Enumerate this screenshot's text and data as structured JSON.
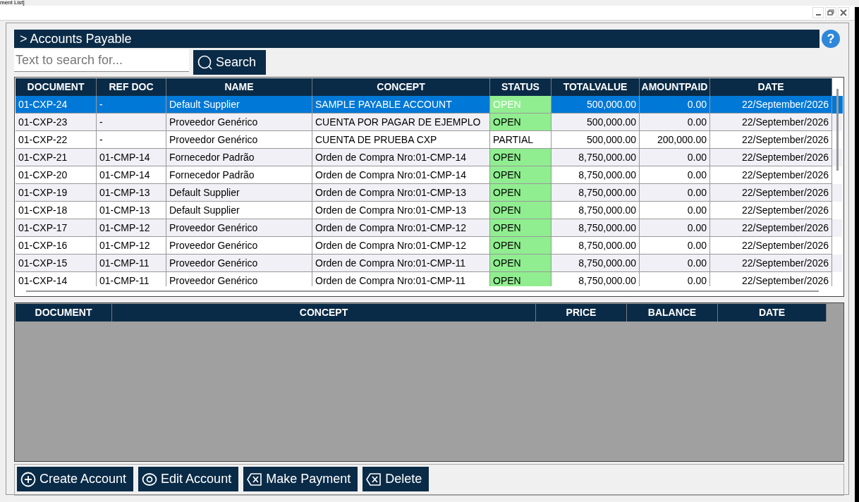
{
  "window": {
    "title": "ment List]"
  },
  "header": {
    "title": "> Accounts Payable",
    "help": "?"
  },
  "search": {
    "placeholder": "Text to search for...",
    "button": "Search"
  },
  "accounts": {
    "columns": [
      "DOCUMENT",
      "REF DOC",
      "NAME",
      "CONCEPT",
      "STATUS",
      "TOTALVALUE",
      "AMOUNTPAID",
      "DATE"
    ],
    "rows": [
      {
        "selected": true,
        "cells": [
          "01-CXP-24",
          "-",
          "Default Supplier",
          "SAMPLE PAYABLE ACCOUNT",
          "OPEN",
          "500,000.00",
          "0.00",
          "22/September/2026"
        ],
        "color": "#90ee90"
      },
      {
        "selected": false,
        "cells": [
          "01-CXP-23",
          "-",
          "Proveedor Genérico",
          "CUENTA POR PAGAR DE EJEMPLO",
          "OPEN",
          "500,000.00",
          "0.00",
          "22/September/2026"
        ],
        "color": "#90ee90"
      },
      {
        "selected": false,
        "cells": [
          "01-CXP-22",
          "-",
          "Proveedor Genérico",
          "CUENTA DE PRUEBA CXP",
          "PARTIAL",
          "500,000.00",
          "200,000.00",
          "22/September/2026"
        ],
        "color": "#ffffff"
      },
      {
        "selected": false,
        "cells": [
          "01-CXP-21",
          "01-CMP-14",
          "Fornecedor Padrão",
          "Orden de Compra Nro:01-CMP-14",
          "OPEN",
          "8,750,000.00",
          "0.00",
          "22/September/2026"
        ],
        "color": "#90ee90"
      },
      {
        "selected": false,
        "cells": [
          "01-CXP-20",
          "01-CMP-14",
          "Fornecedor Padrão",
          "Orden de Compra Nro:01-CMP-14",
          "OPEN",
          "8,750,000.00",
          "0.00",
          "22/September/2026"
        ],
        "color": "#90ee90"
      },
      {
        "selected": false,
        "cells": [
          "01-CXP-19",
          "01-CMP-13",
          "Default Supplier",
          "Orden de Compra Nro:01-CMP-13",
          "OPEN",
          "8,750,000.00",
          "0.00",
          "22/September/2026"
        ],
        "color": "#90ee90"
      },
      {
        "selected": false,
        "cells": [
          "01-CXP-18",
          "01-CMP-13",
          "Default Supplier",
          "Orden de Compra Nro:01-CMP-13",
          "OPEN",
          "8,750,000.00",
          "0.00",
          "22/September/2026"
        ],
        "color": "#90ee90"
      },
      {
        "selected": false,
        "cells": [
          "01-CXP-17",
          "01-CMP-12",
          "Proveedor Genérico",
          "Orden de Compra Nro:01-CMP-12",
          "OPEN",
          "8,750,000.00",
          "0.00",
          "22/September/2026"
        ],
        "color": "#90ee90"
      },
      {
        "selected": false,
        "cells": [
          "01-CXP-16",
          "01-CMP-12",
          "Proveedor Genérico",
          "Orden de Compra Nro:01-CMP-12",
          "OPEN",
          "8,750,000.00",
          "0.00",
          "22/September/2026"
        ],
        "color": "#90ee90"
      },
      {
        "selected": false,
        "cells": [
          "01-CXP-15",
          "01-CMP-11",
          "Proveedor Genérico",
          "Orden de Compra Nro:01-CMP-11",
          "OPEN",
          "8,750,000.00",
          "0.00",
          "22/September/2026"
        ],
        "color": "#90ee90"
      },
      {
        "selected": false,
        "cells": [
          "01-CXP-14",
          "01-CMP-11",
          "Proveedor Genérico",
          "Orden de Compra Nro:01-CMP-11",
          "OPEN",
          "8,750,000.00",
          "0.00",
          "22/September/2026"
        ],
        "color": "#90ee90"
      }
    ]
  },
  "details": {
    "columns": [
      "DOCUMENT",
      "CONCEPT",
      "PRICE",
      "BALANCE",
      "DATE"
    ]
  },
  "buttons": [
    {
      "label": "Create Account",
      "kind": "create"
    },
    {
      "label": "Edit Account",
      "kind": "edit"
    },
    {
      "label": "Make Payment",
      "kind": "pay"
    },
    {
      "label": "Delete",
      "kind": "delete"
    }
  ]
}
